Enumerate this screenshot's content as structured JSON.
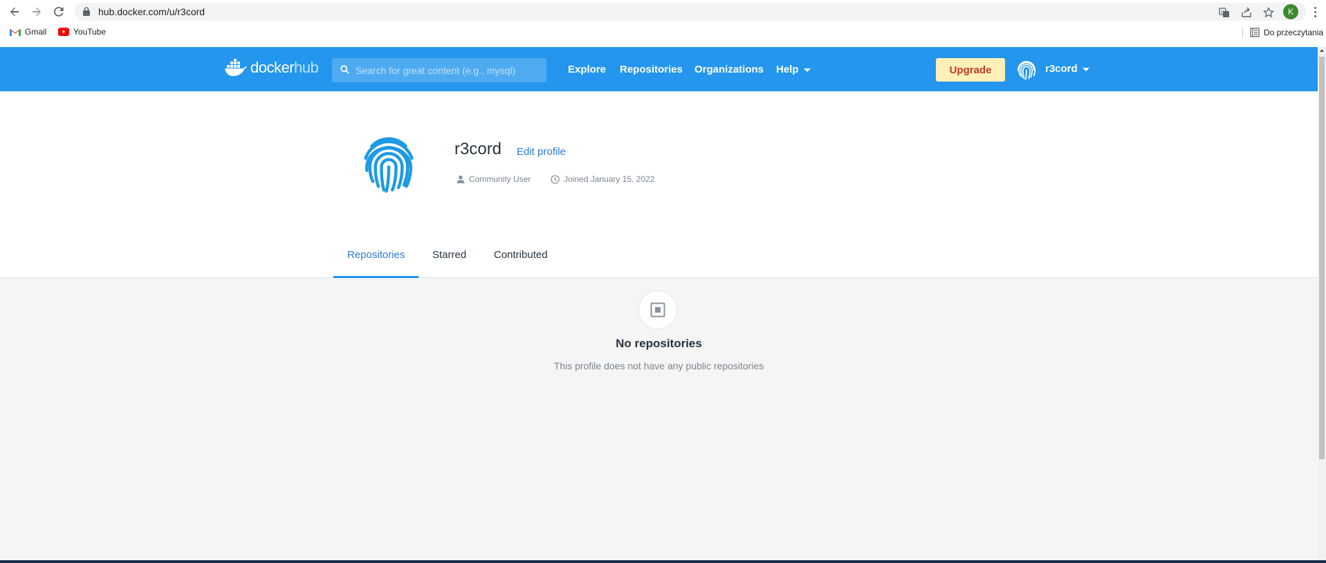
{
  "browser": {
    "url": "hub.docker.com/u/r3cord",
    "profile_initial": "K",
    "bookmarks": [
      {
        "label": "Gmail"
      },
      {
        "label": "YouTube"
      }
    ],
    "reading_list_label": "Do przeczytania"
  },
  "nav": {
    "logo_primary": "docker",
    "logo_secondary": "hub",
    "search_placeholder": "Search for great content (e.g., mysql)",
    "links": [
      "Explore",
      "Repositories",
      "Organizations",
      "Help"
    ],
    "upgrade_label": "Upgrade",
    "username": "r3cord"
  },
  "profile": {
    "username": "r3cord",
    "edit_label": "Edit profile",
    "user_type": "Community User",
    "joined": "Joined January 15, 2022"
  },
  "tabs": [
    {
      "label": "Repositories",
      "active": true
    },
    {
      "label": "Starred",
      "active": false
    },
    {
      "label": "Contributed",
      "active": false
    }
  ],
  "empty_state": {
    "title": "No repositories",
    "subtitle": "This profile does not have any public repositories"
  },
  "colors": {
    "brand_blue": "#2496ed",
    "upgrade_bg": "#fff0b8",
    "link_blue": "#2a7ad6"
  }
}
